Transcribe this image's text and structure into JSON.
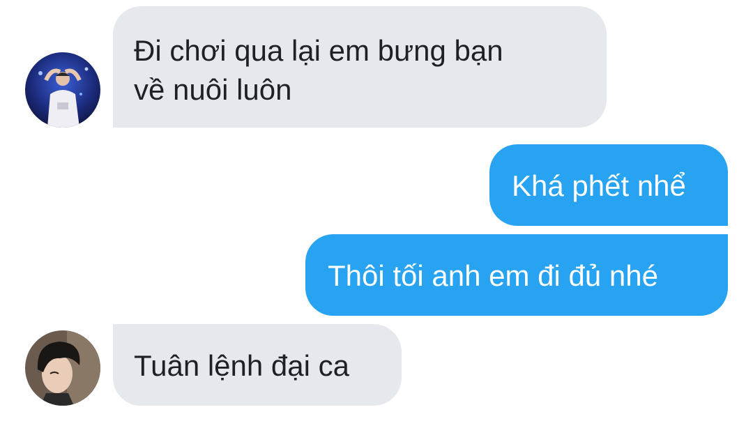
{
  "colors": {
    "incoming_bubble": "#e5e9ee",
    "outgoing_bubble": "#27a3f2",
    "incoming_text": "#1e2124",
    "outgoing_text": "#ffffff"
  },
  "messages": [
    {
      "direction": "incoming",
      "avatar": "avatar-photo-concert",
      "lines": [
        "Đi chơi qua lại em bưng bạn",
        "về nuôi luôn"
      ]
    },
    {
      "direction": "outgoing",
      "lines": [
        "Khá phết nhể"
      ]
    },
    {
      "direction": "outgoing",
      "lines": [
        "Thôi tối anh em đi đủ nhé"
      ]
    },
    {
      "direction": "incoming",
      "avatar": "avatar-photo-portrait",
      "lines": [
        "Tuân lệnh đại ca"
      ]
    }
  ]
}
